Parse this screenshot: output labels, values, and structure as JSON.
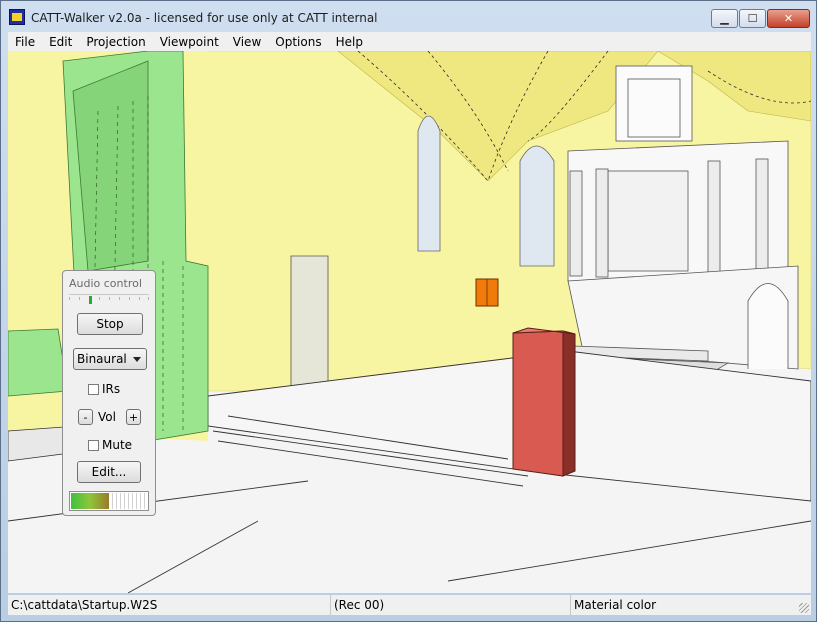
{
  "window": {
    "title": "CATT-Walker v2.0a - licensed for use only at CATT internal",
    "minimize_glyph": "▁",
    "maximize_glyph": "☐",
    "close_glyph": "✕"
  },
  "menu": [
    {
      "label": "File"
    },
    {
      "label": "Edit"
    },
    {
      "label": "Projection"
    },
    {
      "label": "Viewpoint"
    },
    {
      "label": "View"
    },
    {
      "label": "Options"
    },
    {
      "label": "Help"
    }
  ],
  "audio_control": {
    "title": "Audio control",
    "stop_label": "Stop",
    "mode_value": "Binaural",
    "irs_label": "IRs",
    "irs_checked": false,
    "vol_minus": "-",
    "vol_label": "Vol",
    "vol_plus": "+",
    "mute_label": "Mute",
    "mute_checked": false,
    "edit_label": "Edit...",
    "level_meter_fraction": 0.5
  },
  "status": {
    "path": "C:\\cattdata\\Startup.W2S",
    "rec": "(Rec 00)",
    "mode": "Material color"
  },
  "colors": {
    "wall_yellow": "#f7f4a2",
    "floor_white": "#f4f4f4",
    "column_green": "#9be58f",
    "source_red": "#d85a50",
    "marker_orange": "#f07a0a"
  }
}
